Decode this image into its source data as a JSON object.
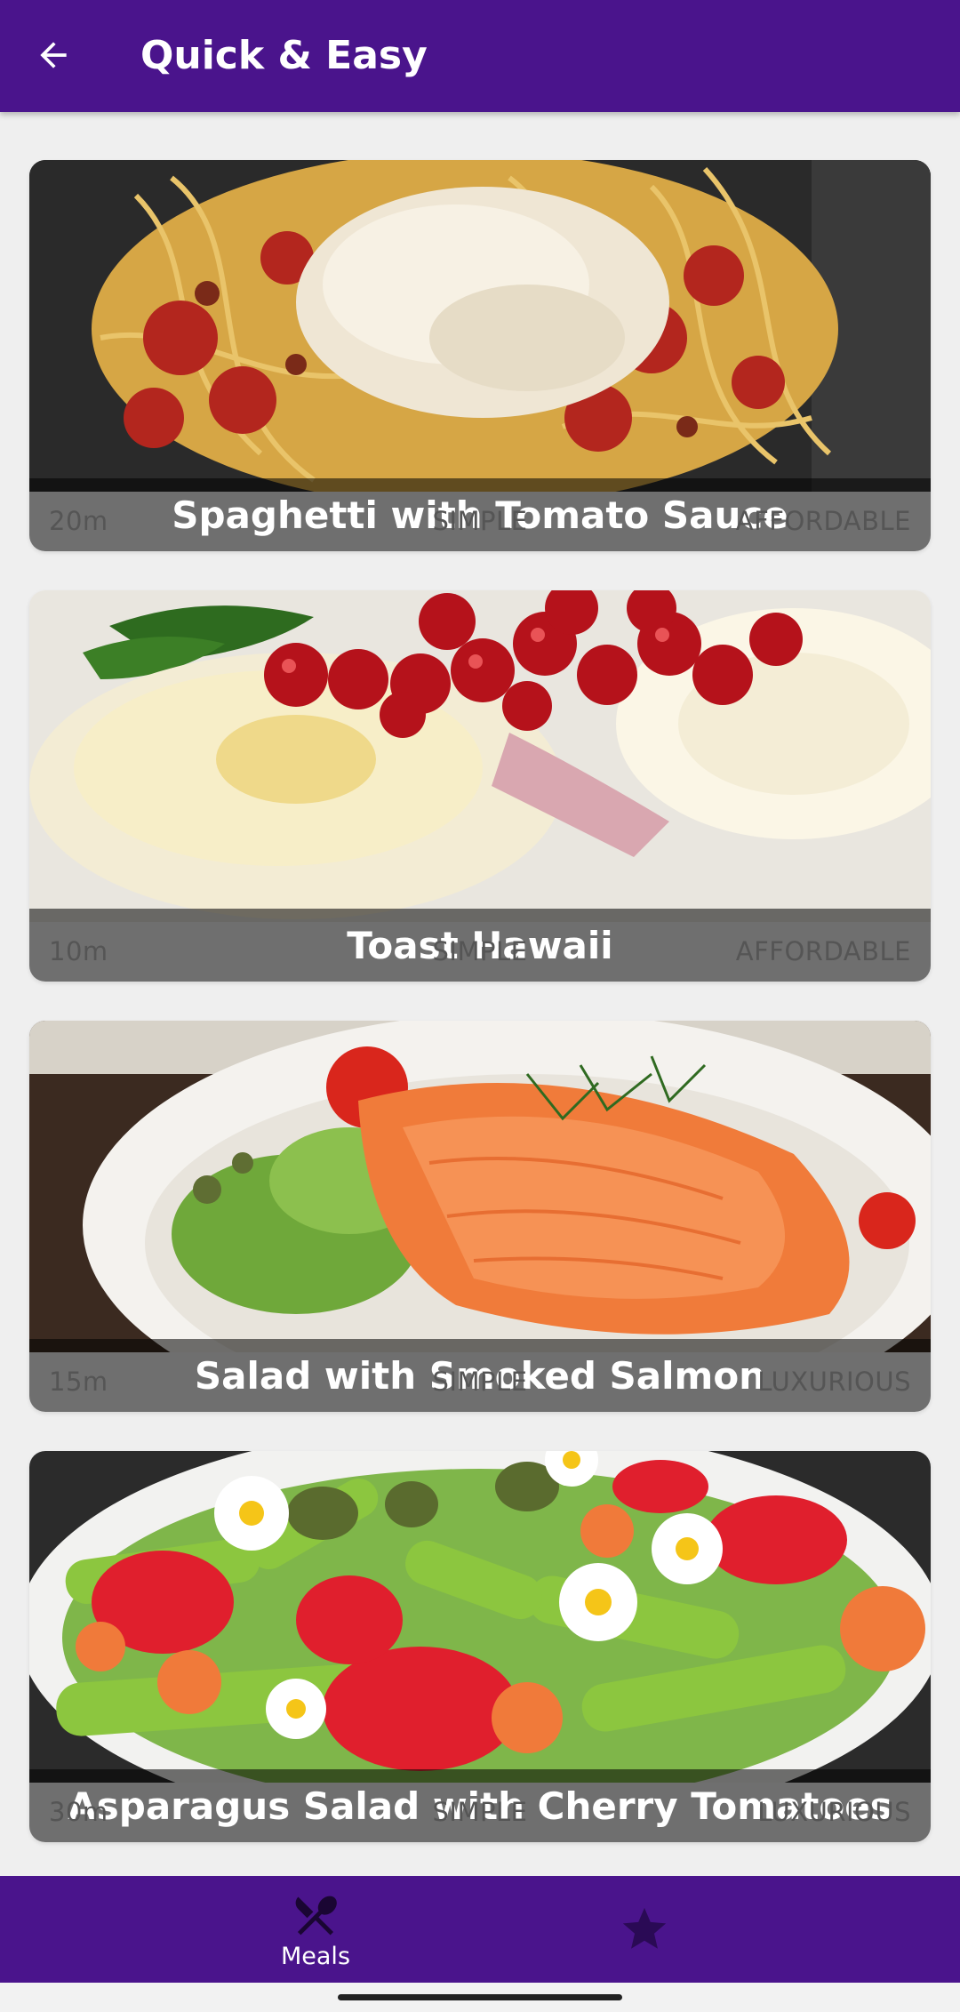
{
  "header": {
    "title": "Quick & Easy",
    "back_icon": "arrow-back-icon"
  },
  "meals": [
    {
      "title": "Spaghetti with Tomato Sauce",
      "duration": "20m",
      "complexity": "SIMPLE",
      "affordability": "AFFORDABLE",
      "image": "spaghetti-photo"
    },
    {
      "title": "Toast Hawaii",
      "duration": "10m",
      "complexity": "SIMPLE",
      "affordability": "AFFORDABLE",
      "image": "toast-hawaii-photo"
    },
    {
      "title": "Salad with Smoked Salmon",
      "duration": "15m",
      "complexity": "SIMPLE",
      "affordability": "LUXURIOUS",
      "image": "smoked-salmon-salad-photo"
    },
    {
      "title": "Asparagus Salad with Cherry Tomatoes",
      "duration": "30m",
      "complexity": "SIMPLE",
      "affordability": "LUXURIOUS",
      "image": "asparagus-salad-photo"
    }
  ],
  "bottom_nav": {
    "items": [
      {
        "label": "Meals",
        "icon": "fork-knife-icon",
        "active": true
      },
      {
        "label": "",
        "icon": "star-icon",
        "active": false
      }
    ]
  },
  "colors": {
    "primary": "#4a148c",
    "background": "#efefef",
    "card": "#f7f7f7",
    "info_text": "#555555",
    "inactive_icon": "#2a0a55"
  }
}
